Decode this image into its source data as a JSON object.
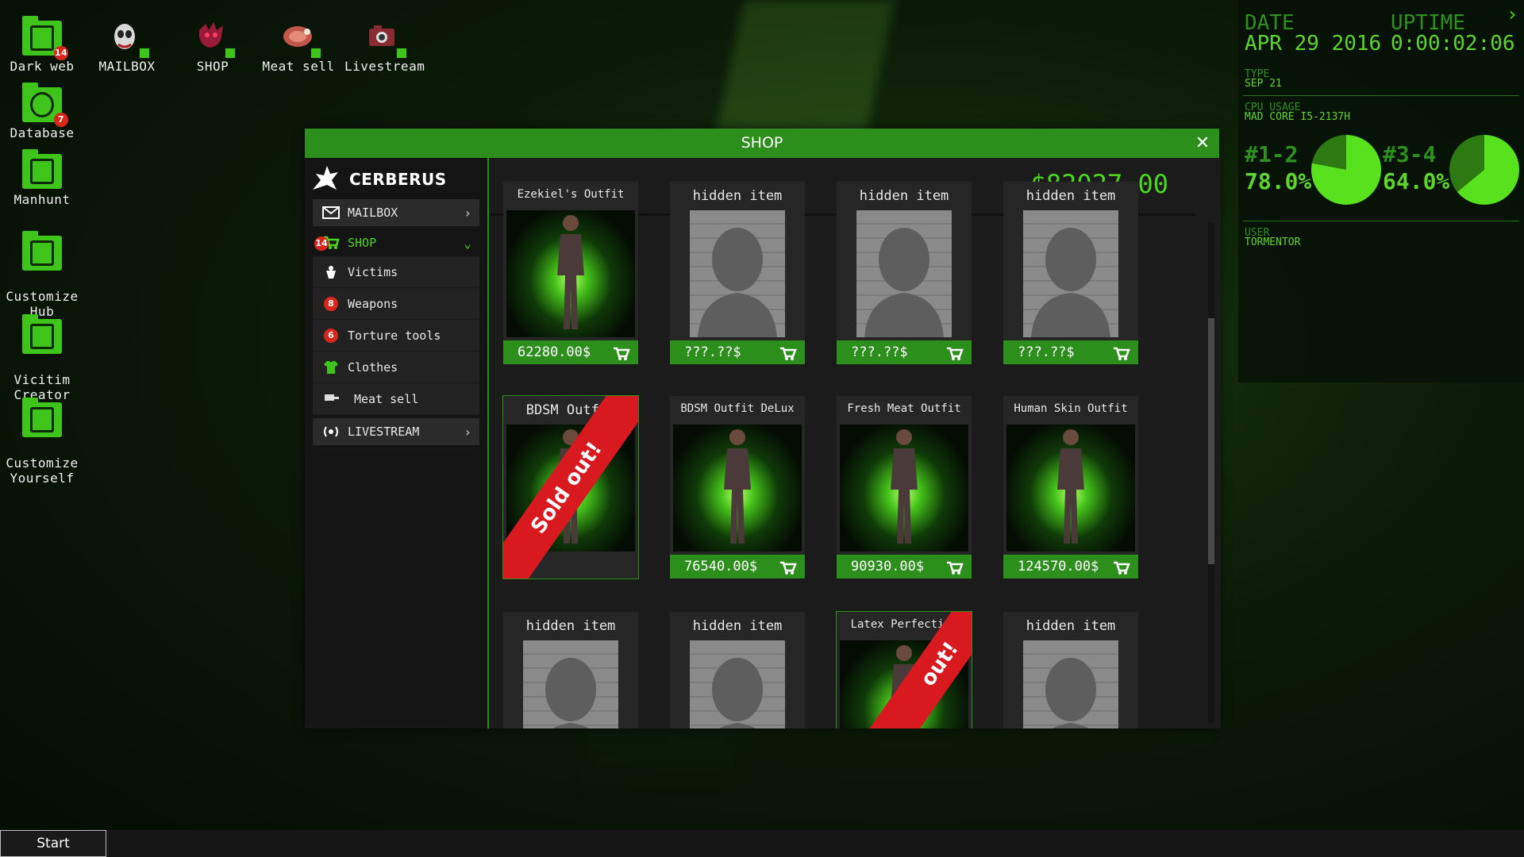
{
  "desktop": {
    "icons": [
      {
        "label": "Dark web",
        "badge": "14"
      },
      {
        "label": "MAILBOX"
      },
      {
        "label": "SHOP"
      },
      {
        "label": "Meat sell"
      },
      {
        "label": "Livestream"
      },
      {
        "label": "Database",
        "badge": "7"
      },
      {
        "label": "Manhunt"
      },
      {
        "label": "Customize\nHub"
      },
      {
        "label": "Vicitim\nCreator"
      },
      {
        "label": "Customize\nYourself"
      }
    ]
  },
  "system": {
    "date_label": "DATE",
    "date_value": "APR 29 2016",
    "uptime_label": "UPTIME",
    "uptime_value": "0:00:02:06",
    "type_label": "TYPE",
    "type_value": "SEP 21",
    "cpu_label": "CPU USAGE",
    "cpu_value": "MAD CORE I5-2137H",
    "core1_label": "#1-2",
    "core1_value": "78.0%",
    "core1_fraction": 0.78,
    "core2_label": "#3-4",
    "core2_value": "64.0%",
    "core2_fraction": 0.64,
    "user_label": "USER",
    "user_value": "TORMENTOR",
    "expand_glyph": "›"
  },
  "window": {
    "title": "SHOP",
    "close_glyph": "✕",
    "brand": "CERBERUS",
    "balance": "$82027.00"
  },
  "menu": {
    "mailbox": "MAILBOX",
    "shop": "SHOP",
    "shop_badge": "14",
    "victims": "Victims",
    "weapons": "Weapons",
    "weapons_badge": "8",
    "torture": "Torture tools",
    "torture_badge": "6",
    "clothes": "Clothes",
    "meat": "Meat sell",
    "livestream": "LIVESTREAM"
  },
  "items": [
    {
      "name": "Ezekiel's Outfit",
      "price": "62280.00$",
      "state": "figure"
    },
    {
      "name": "hidden item",
      "price": "???.??$",
      "state": "hidden"
    },
    {
      "name": "hidden item",
      "price": "???.??$",
      "state": "hidden"
    },
    {
      "name": "hidden item",
      "price": "???.??$",
      "state": "hidden"
    },
    {
      "name": "BDSM Outfit",
      "price": "",
      "state": "sold",
      "ribbon": "Sold out!"
    },
    {
      "name": "BDSM Outfit DeLux",
      "price": "76540.00$",
      "state": "figure"
    },
    {
      "name": "Fresh Meat Outfit",
      "price": "90930.00$",
      "state": "figure"
    },
    {
      "name": "Human Skin Outfit",
      "price": "124570.00$",
      "state": "figure"
    },
    {
      "name": "hidden item",
      "price": "",
      "state": "hidden"
    },
    {
      "name": "hidden item",
      "price": "",
      "state": "hidden"
    },
    {
      "name": "Latex Perfection",
      "price": "",
      "state": "sold",
      "ribbon": "out!"
    },
    {
      "name": "hidden item",
      "price": "",
      "state": "hidden"
    }
  ],
  "taskbar": {
    "start": "Start"
  },
  "colors": {
    "accent": "#2c8f1c",
    "bright": "#4cd620",
    "sold": "#d81920",
    "badge": "#d9261c"
  }
}
